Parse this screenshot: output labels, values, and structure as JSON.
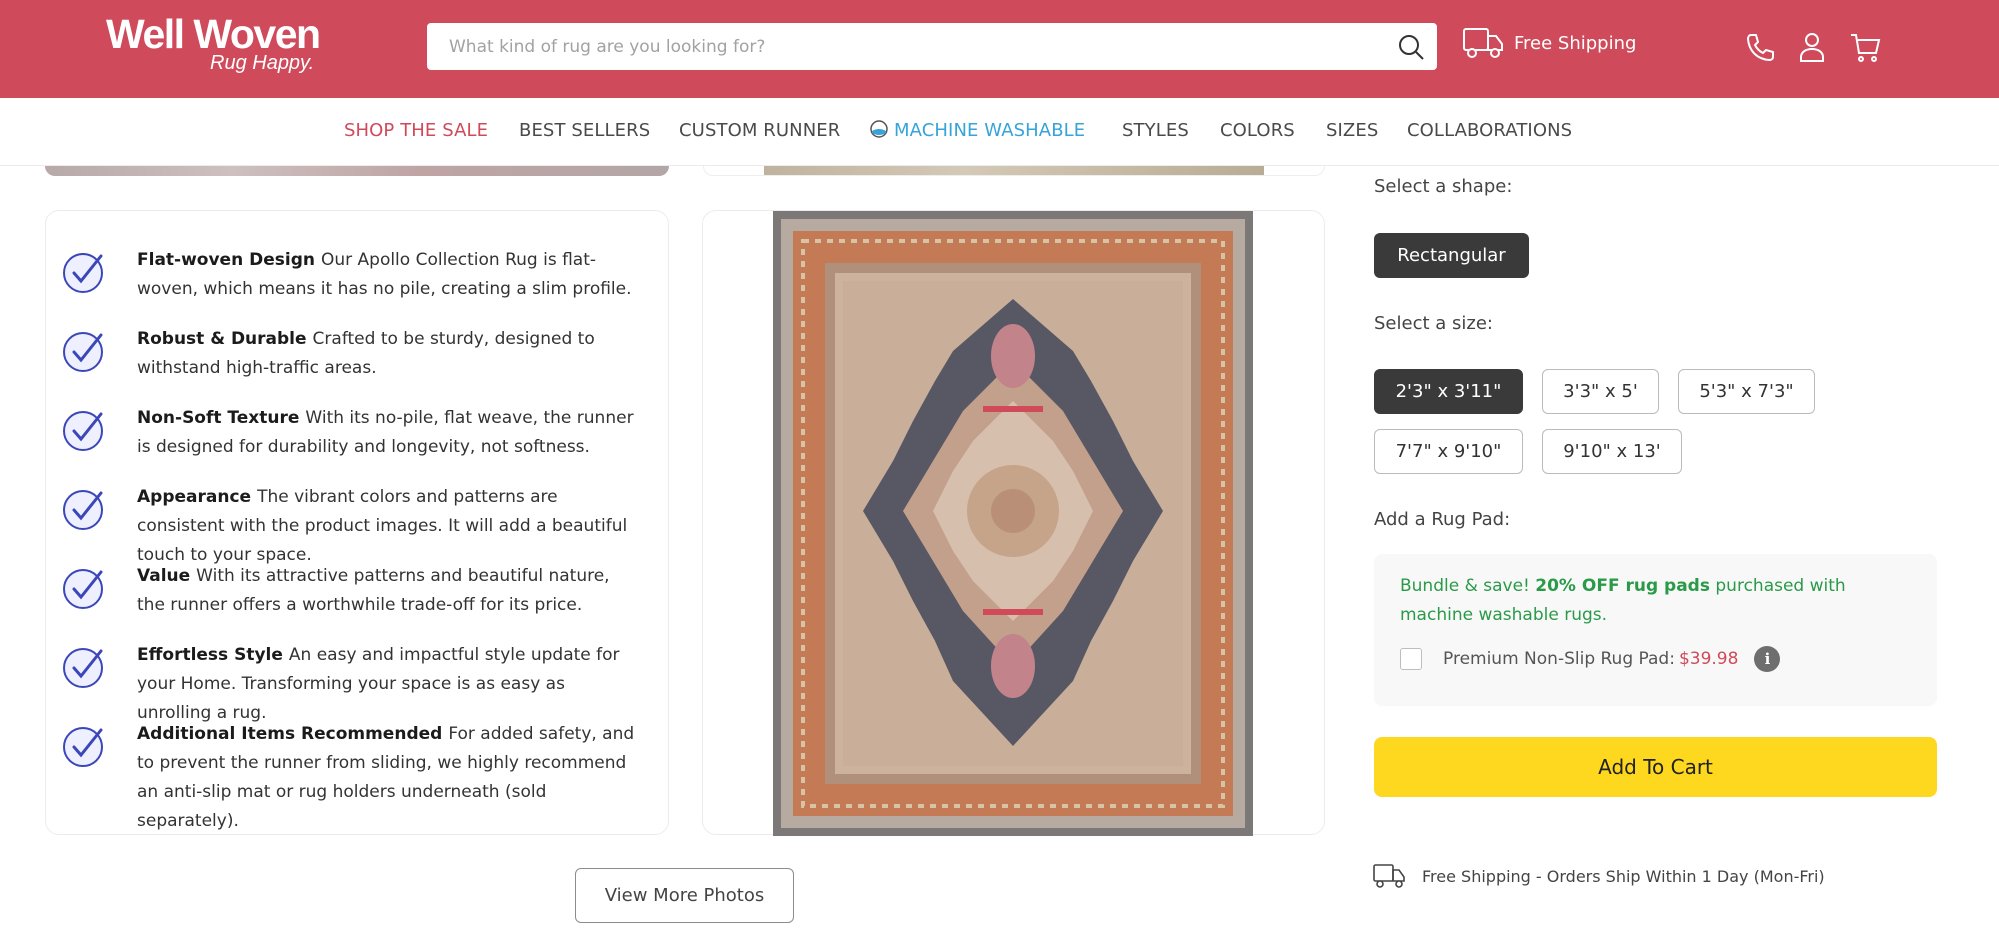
{
  "header": {
    "brand": "Well Woven",
    "tagline": "Rug Happy.",
    "search_placeholder": "What kind of rug are you looking for?",
    "shipping_label": "Free Shipping",
    "icons": [
      "search-icon",
      "truck-icon",
      "phone-icon",
      "user-icon",
      "cart-icon"
    ],
    "brand_color": "#cf4a5b"
  },
  "nav": {
    "items": [
      {
        "label": "SHOP THE SALE",
        "color": "#cf4a5b"
      },
      {
        "label": "BEST SELLERS"
      },
      {
        "label": "CUSTOM RUNNER"
      },
      {
        "label": "MACHINE WASHABLE",
        "color": "#36a4d9",
        "icon": "globe-icon"
      },
      {
        "label": "STYLES"
      },
      {
        "label": "COLORS"
      },
      {
        "label": "SIZES"
      },
      {
        "label": "COLLABORATIONS"
      }
    ]
  },
  "features": [
    {
      "title": "Flat-woven Design",
      "text": "Our Apollo Collection Rug is flat-woven, which means it has no pile, creating a slim profile."
    },
    {
      "title": "Robust & Durable",
      "text": "Crafted to be sturdy, designed to withstand high-traffic areas."
    },
    {
      "title": "Non-Soft Texture",
      "text": "With its no-pile, flat weave, the runner is designed for durability and longevity, not softness."
    },
    {
      "title": "Appearance",
      "text": "The vibrant colors and patterns are consistent with the product images. It will add a beautiful touch to your space."
    },
    {
      "title": "Value",
      "text": "With its attractive patterns and beautiful nature, the runner offers a worthwhile trade-off for its price."
    },
    {
      "title": "Effortless Style",
      "text": "An easy and impactful style update for your Home. Transforming your space is as easy as unrolling a rug."
    },
    {
      "title": "Additional Items Recommended",
      "text": "For added safety, and to prevent the runner from sliding, we highly recommend an anti-slip mat or rug holders underneath (sold separately)."
    }
  ],
  "gallery": {
    "view_more_label": "View More Photos"
  },
  "options": {
    "shape_label": "Select a shape:",
    "shape_selected": "Rectangular",
    "size_label": "Select a size:",
    "sizes": [
      "2'3\" x 3'11\"",
      "3'3\" x 5'",
      "5'3\" x 7'3\"",
      "7'7\" x 9'10\"",
      "9'10\" x 13'"
    ],
    "size_selected": "2'3\" x 3'11\"",
    "pad_label": "Add a Rug Pad:"
  },
  "rug_pad": {
    "promo_prefix": "Bundle & save! ",
    "promo_bold": "20% OFF rug pads",
    "promo_suffix": " purchased with machine washable rugs.",
    "item_label": "Premium Non-Slip Rug Pad:",
    "price": "$39.98",
    "checked": false,
    "promo_color": "#2a9a49"
  },
  "cart": {
    "add_label": "Add To Cart",
    "button_color": "#fed71f"
  },
  "shipping_note": "Free Shipping - Orders Ship Within 1 Day (Mon-Fri)"
}
